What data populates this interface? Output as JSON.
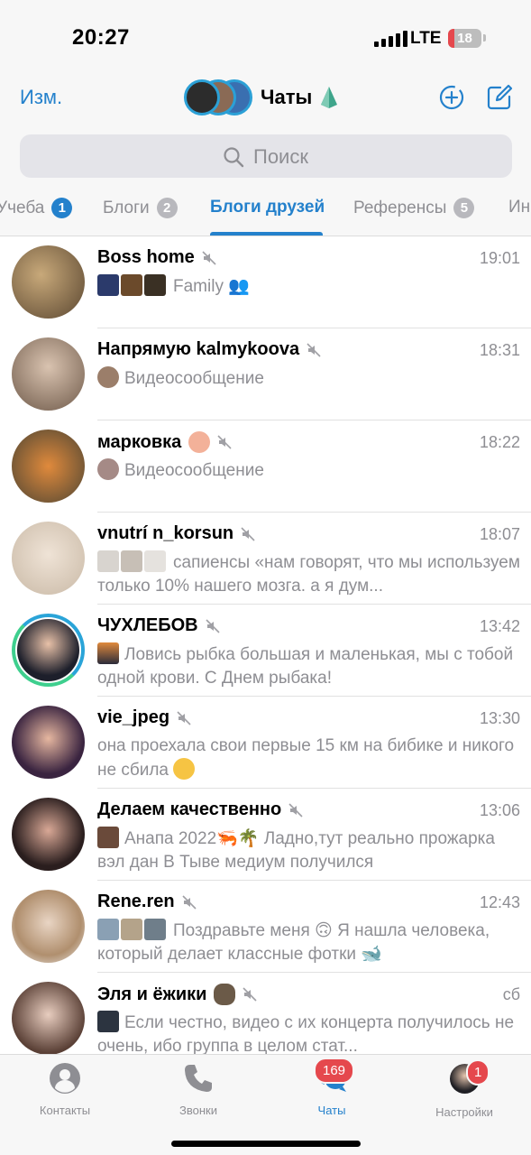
{
  "status_bar": {
    "time": "20:27",
    "network": "LTE",
    "battery": "18",
    "battery_level_percent": 18
  },
  "header": {
    "edit_label": "Изм.",
    "title": "Чаты"
  },
  "search": {
    "placeholder": "Поиск"
  },
  "folders": [
    {
      "label": "Учеба",
      "badge": "1"
    },
    {
      "label": "Блоги",
      "badge": "2"
    },
    {
      "label": "Блоги друзей",
      "badge": ""
    },
    {
      "label": "Референсы",
      "badge": "5"
    },
    {
      "label": "Ин",
      "badge": ""
    }
  ],
  "chats": [
    {
      "name": "Boss home",
      "time": "19:01",
      "message": "Family 👥"
    },
    {
      "name": "Напрямую kalmykoova",
      "time": "18:31",
      "message": "Видеосообщение"
    },
    {
      "name": "марковка",
      "time": "18:22",
      "message": "Видеосообщение"
    },
    {
      "name": "vnutrí n_korsun",
      "time": "18:07",
      "message": "сапиенсы «нам говорят, что мы используем только 10% нашего мозга. а я дум..."
    },
    {
      "name": "ЧУХЛЕБОВ",
      "time": "13:42",
      "message": "Ловись рыбка большая и маленькая, мы с тобой одной крови. С Днем рыбака!"
    },
    {
      "name": "vie_jpeg",
      "time": "13:30",
      "message": "она проехала свои первые 15 км на бибике и никого не сбила"
    },
    {
      "name": "Делаем качественно",
      "time": "13:06",
      "message": "Анапа 2022🦐🌴 Ладно,тут реально прожарка вэл дан В Тыве медиум получился"
    },
    {
      "name": "Rene.ren",
      "time": "12:43",
      "message": "Поздравьте меня 🙃 Я нашла человека, который делает классные фотки 🐋"
    },
    {
      "name": "Эля и ёжики",
      "time": "сб",
      "message": "Если честно, видео с их концерта получилось не очень, ибо группа в целом стат..."
    }
  ],
  "tab_bar": {
    "contacts": "Контакты",
    "calls": "Звонки",
    "chats": "Чаты",
    "chats_badge": "169",
    "settings": "Настройки",
    "settings_badge": "1"
  },
  "colors": {
    "accent": "#2481cc",
    "badge_red": "#e5484d",
    "muted_text": "#8e8e93"
  }
}
